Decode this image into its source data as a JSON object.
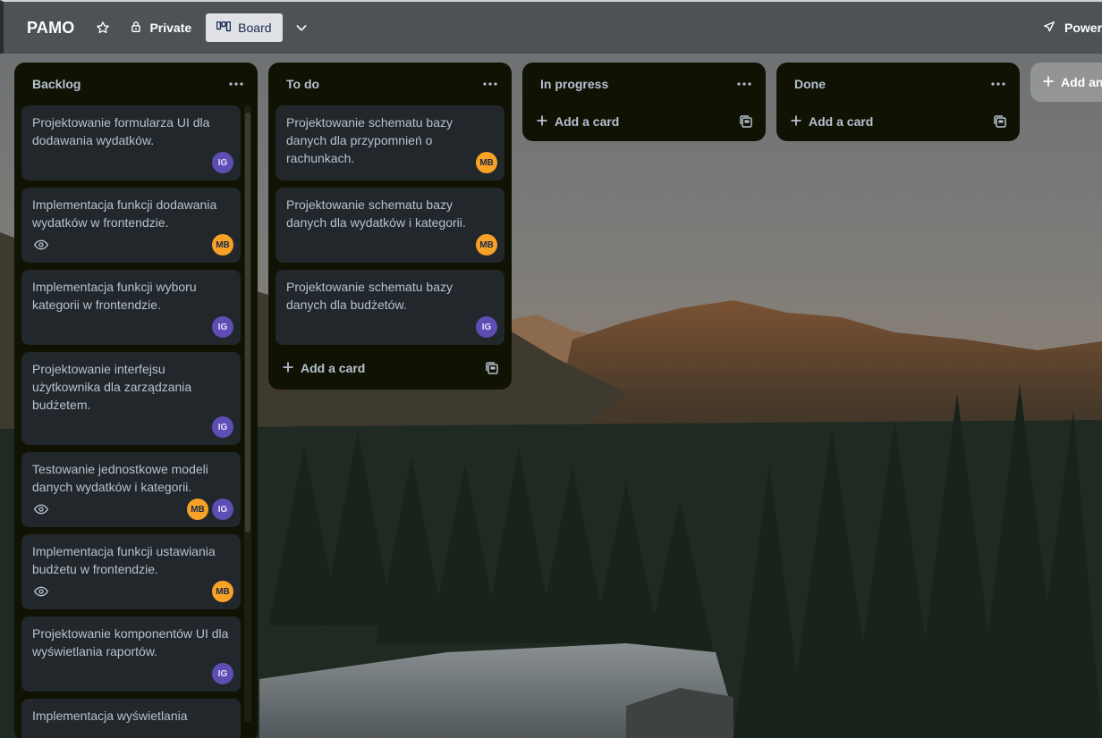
{
  "board": {
    "title": "PAMO",
    "visibility": "Private",
    "view": "Board",
    "power_ups": "Power-ups",
    "add_list": "Add another list"
  },
  "colors": {
    "list_bg": "#101204",
    "card_bg": "#22272b",
    "text": "#b6c2cf",
    "avatar_ig": "#5e4db2",
    "avatar_mb": "#f8a127"
  },
  "lists": [
    {
      "title": "Backlog",
      "cards": [
        {
          "title": "Projektowanie formularza UI dla dodawania wydatków.",
          "avatars": [
            "IG"
          ],
          "watch": false
        },
        {
          "title": "Implementacja funkcji dodawania wydatków w frontendzie.",
          "avatars": [
            "MB"
          ],
          "watch": true
        },
        {
          "title": "Implementacja funkcji wyboru kategorii w frontendzie.",
          "avatars": [
            "IG"
          ],
          "watch": false
        },
        {
          "title": "Projektowanie interfejsu użytkownika dla zarządzania budżetem.",
          "avatars": [
            "IG"
          ],
          "watch": false
        },
        {
          "title": "Testowanie jednostkowe modeli danych wydatków i kategorii.",
          "avatars": [
            "MB",
            "IG"
          ],
          "watch": true
        },
        {
          "title": "Implementacja funkcji ustawiania budżetu w frontendzie.",
          "avatars": [
            "MB"
          ],
          "watch": true
        },
        {
          "title": "Projektowanie komponentów UI dla wyświetlania raportów.",
          "avatars": [
            "IG"
          ],
          "watch": false
        },
        {
          "title": "Implementacja wyświetlania",
          "avatars": [],
          "watch": false
        }
      ]
    },
    {
      "title": "To do",
      "cards": [
        {
          "title": "Projektowanie schematu bazy danych dla przypomnień o rachunkach.",
          "avatars": [
            "MB"
          ],
          "watch": false
        },
        {
          "title": "Projektowanie schematu bazy danych dla wydatków i kategorii.",
          "avatars": [
            "MB"
          ],
          "watch": false
        },
        {
          "title": "Projektowanie schematu bazy danych dla budżetów.",
          "avatars": [
            "IG"
          ],
          "watch": false
        }
      ],
      "add_card": "Add a card"
    },
    {
      "title": "In progress",
      "cards": [],
      "add_card": "Add a card"
    },
    {
      "title": "Done",
      "cards": [],
      "add_card": "Add a card"
    }
  ]
}
